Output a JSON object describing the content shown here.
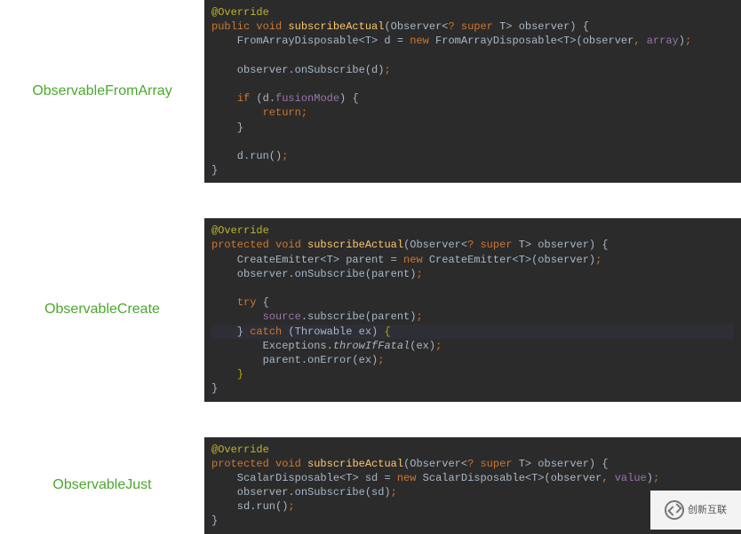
{
  "blocks": [
    {
      "label": "ObservableFromArray",
      "code_html": "<span class=\"ann\">@Override</span>\n<span class=\"kw\">public void </span><span class=\"mname\">subscribeActual</span>(Observer&lt;<span class=\"kw\">?</span> <span class=\"kw\">super</span> <span class=\"param\">T</span>&gt; observer) {\n    FromArrayDisposable&lt;<span class=\"param\">T</span>&gt; d = <span class=\"kw\">new</span> FromArrayDisposable&lt;<span class=\"param\">T</span>&gt;(observer<span class=\"kw\">, </span><span class=\"field\">array</span>)<span class=\"kw\">;</span>\n\n    observer.onSubscribe(d)<span class=\"kw\">;</span>\n\n    <span class=\"kw\">if</span> (d.<span class=\"field\">fusionMode</span>) {\n        <span class=\"kw\">return;</span>\n    }\n\n    d.run()<span class=\"kw\">;</span>\n}"
    },
    {
      "label": "ObservableCreate",
      "code_html": "<span class=\"ann\">@Override</span>\n<span class=\"kw\">protected void </span><span class=\"mname\">subscribeActual</span>(Observer&lt;<span class=\"kw\">?</span> <span class=\"kw\">super</span> <span class=\"param\">T</span>&gt; observer) {\n    CreateEmitter&lt;<span class=\"param\">T</span>&gt; parent = <span class=\"kw\">new</span> CreateEmitter&lt;<span class=\"param\">T</span>&gt;(observer)<span class=\"kw\">;</span>\n    observer.onSubscribe(parent)<span class=\"kw\">;</span>\n\n    <span class=\"kw\">try</span> {\n        <span class=\"field\">source</span>.subscribe(parent)<span class=\"kw\">;</span>\n<span class=\"hlline\">    } <span class=\"kw\">catch</span> (Throwable ex) <span class=\"yel\">{</span></span>\n        Exceptions.<span class=\"static\">throwIfFatal</span>(ex)<span class=\"kw\">;</span>\n        parent.onError(ex)<span class=\"kw\">;</span>\n    <span class=\"yel\">}</span>\n}"
    },
    {
      "label": "ObservableJust",
      "code_html": "<span class=\"ann\">@Override</span>\n<span class=\"kw\">protected void </span><span class=\"mname\">subscribeActual</span>(Observer&lt;<span class=\"kw\">?</span> <span class=\"kw\">super</span> <span class=\"param\">T</span>&gt; observer) {\n    ScalarDisposable&lt;<span class=\"param\">T</span>&gt; sd = <span class=\"kw\">new</span> ScalarDisposable&lt;<span class=\"param\">T</span>&gt;(observer<span class=\"kw\">, </span><span class=\"field\">value</span>)<span class=\"kw\">;</span>\n    observer.onSubscribe(sd)<span class=\"kw\">;</span>\n    sd.run()<span class=\"kw\">;</span>\n}"
    }
  ],
  "watermark": {
    "text": "创新互联"
  }
}
